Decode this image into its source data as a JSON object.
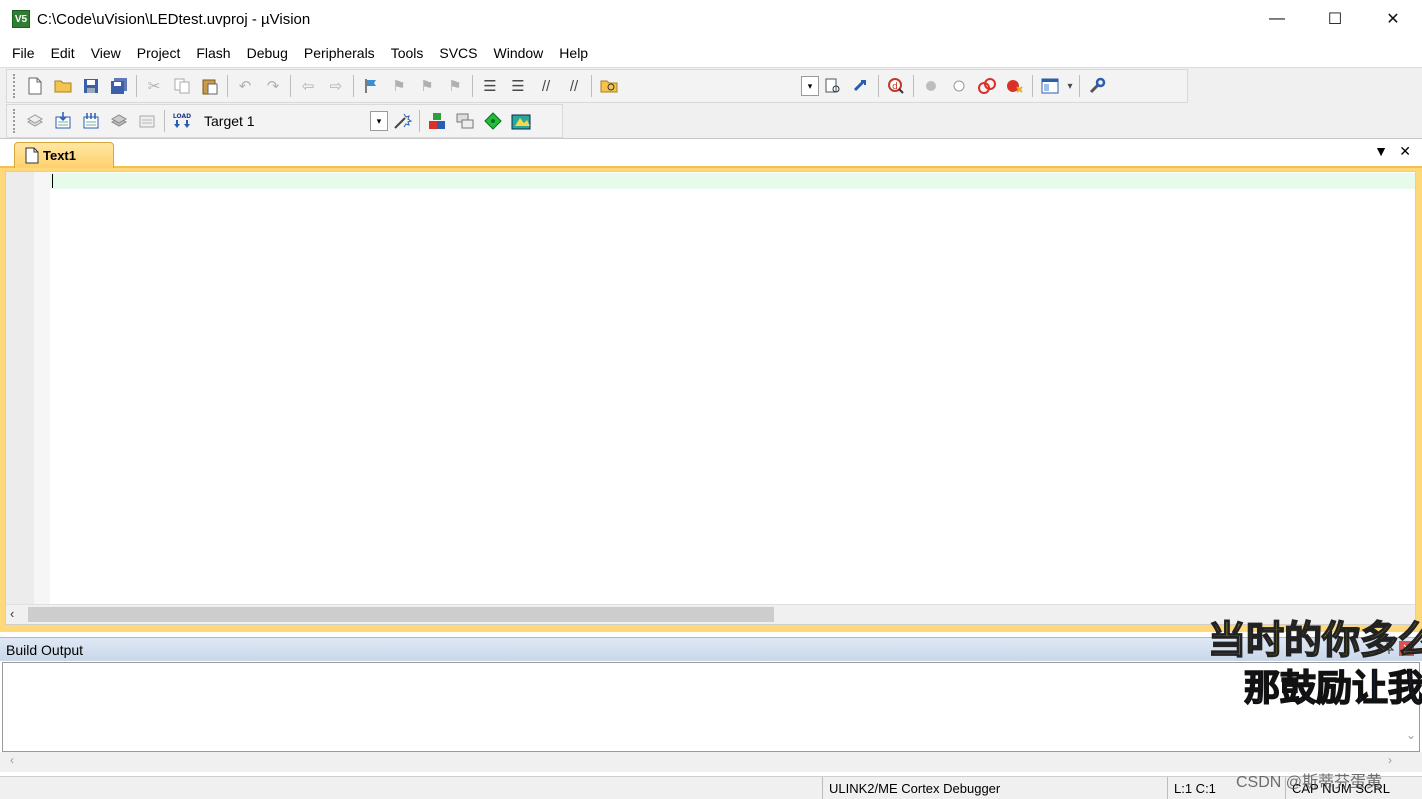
{
  "window": {
    "title": "C:\\Code\\uVision\\LEDtest.uvproj - µVision",
    "app_icon_text": "V5",
    "minimize_glyph": "—",
    "maximize_glyph": "☐",
    "close_glyph": "✕"
  },
  "menu": {
    "items": [
      "File",
      "Edit",
      "View",
      "Project",
      "Flash",
      "Debug",
      "Peripherals",
      "Tools",
      "SVCS",
      "Window",
      "Help"
    ]
  },
  "toolbar": {
    "target_label": "Target 1",
    "combo_arrow": "▾"
  },
  "editor": {
    "tab_label": "Text1",
    "tab_menu_glyph": "▼",
    "tab_close_glyph": "✕",
    "scroll_left_glyph": "‹"
  },
  "build_output": {
    "title": "Build Output",
    "pin_glyph": "📌",
    "close_glyph": "✕",
    "scroll_left_glyph": "‹",
    "scroll_right_glyph": "›",
    "scroll_down_glyph": "⌄"
  },
  "statusbar": {
    "debugger": "ULINK2/ME Cortex Debugger",
    "position": "L:1 C:1",
    "indicators": "CAP  NUM  SCRL"
  },
  "overlay": {
    "subtitle_line1": "当时的你多么",
    "subtitle_line2": "那鼓励让我",
    "watermark": "CSDN @斯蒂芬蛋黄"
  },
  "colors": {
    "tab_active": "#ffd06b",
    "current_line": "#e6fbe9",
    "build_header": "#c9d7ea",
    "subtitle_yellow": "#f7e82a",
    "subtitle_blue": "#2a6fc9"
  }
}
